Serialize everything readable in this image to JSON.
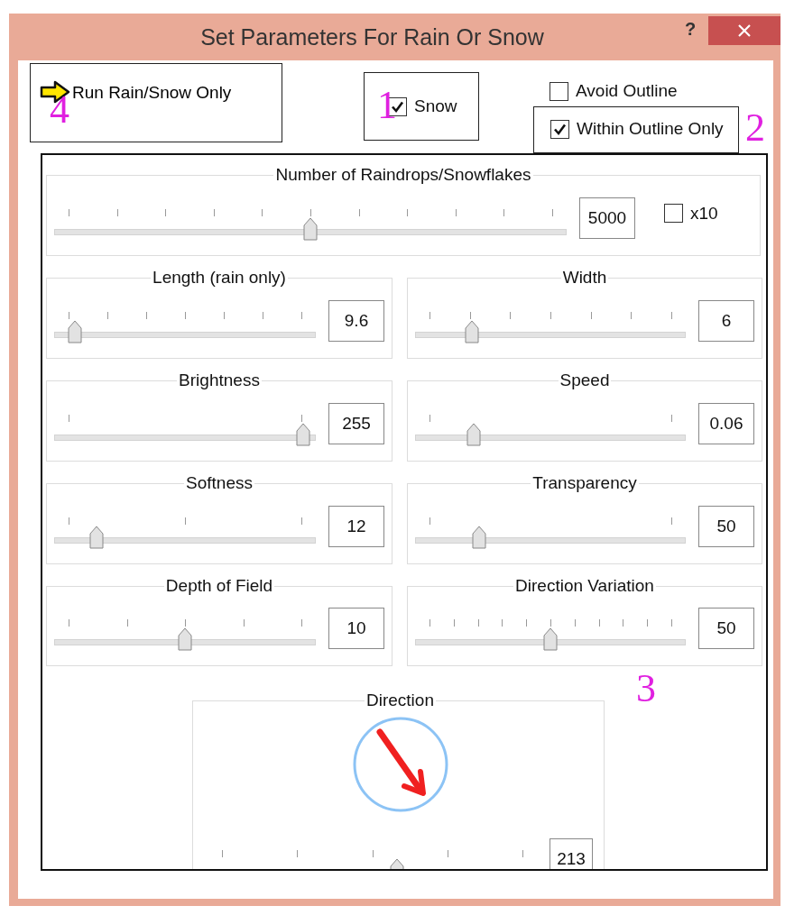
{
  "window": {
    "title": "Set Parameters For Rain Or Snow",
    "help": "?"
  },
  "run_button": {
    "label": "Run Rain/Snow Only"
  },
  "snow": {
    "label": "Snow",
    "checked": true
  },
  "avoid_outline": {
    "label": "Avoid Outline",
    "checked": false
  },
  "within_outline": {
    "label": "Within Outline Only",
    "checked": true
  },
  "count": {
    "title": "Number of Raindrops/Snowflakes",
    "level": 0.5,
    "value": "5000",
    "x10": {
      "label": "x10",
      "checked": false
    }
  },
  "sliders": [
    {
      "title": "Length (rain only)",
      "level": 0.05,
      "value": "9.6"
    },
    {
      "title": "Width",
      "level": 0.19,
      "value": "6"
    },
    {
      "title": "Brightness",
      "level": 0.98,
      "value": "255"
    },
    {
      "title": "Speed",
      "level": 0.2,
      "value": "0.06"
    },
    {
      "title": "Softness",
      "level": 0.14,
      "value": "12"
    },
    {
      "title": "Transparency",
      "level": 0.22,
      "value": "50"
    },
    {
      "title": "Depth of Field",
      "level": 0.5,
      "value": "10"
    },
    {
      "title": "Direction Variation",
      "level": 0.5,
      "value": "50"
    }
  ],
  "direction": {
    "title": "Direction",
    "level": 0.58,
    "value": "213"
  },
  "annotations": [
    {
      "text": "4"
    },
    {
      "text": "1"
    },
    {
      "text": "2"
    },
    {
      "text": "3"
    }
  ]
}
